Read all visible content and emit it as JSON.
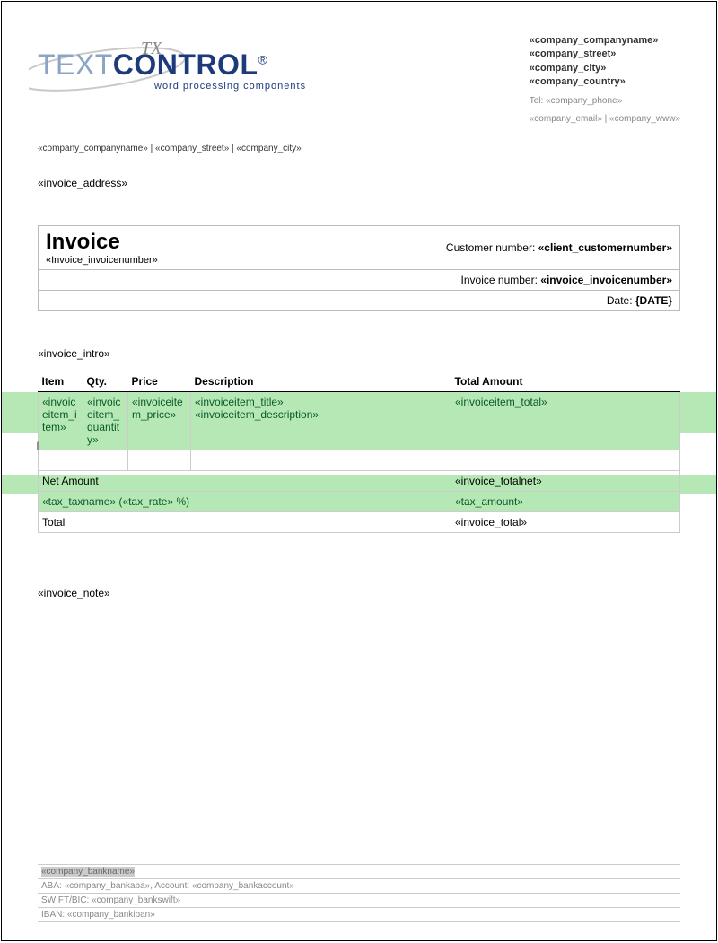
{
  "logo": {
    "text_light": "TEXT",
    "text_bold": "CONTROL",
    "reg": "®",
    "sub": "word processing components",
    "tx": "TX"
  },
  "company_block": {
    "l1": "«company_companyname»",
    "l2": "«company_street»",
    "l3": "«company_city»",
    "l4": "«company_country»",
    "tel_label": "Tel: ",
    "tel": "«company_phone»",
    "contact": "«company_email» | «company_www»"
  },
  "small_line": "«company_companyname» | «company_street» | «company_city»",
  "invoice_address": "«invoice_address»",
  "inv": {
    "title": "Invoice",
    "num_under": "«Invoice_invoicenumber»",
    "cust_label": "Customer number: ",
    "cust_val": "«client_customernumber»",
    "invnum_label": "Invoice number: ",
    "invnum_val": "«invoice_invoicenumber»",
    "date_label": "Date: ",
    "date_val": "{DATE}"
  },
  "intro": "«invoice_intro»",
  "cols": {
    "item": "Item",
    "qty": "Qty.",
    "price": "Price",
    "desc": "Description",
    "total": "Total Amount"
  },
  "row": {
    "item": "«invoiceitem_item»",
    "qty": "«invoiceitem_quantity»",
    "price": "«invoiceitem_price»",
    "title": "«invoiceitem_title»",
    "desc": "«invoiceitem_description»",
    "total": "«invoiceitem_total»"
  },
  "totals": {
    "net_label": "Net Amount",
    "net_val": "«invoice_totalnet»",
    "tax_name": "«tax_taxname»",
    "tax_rate": "«tax_rate»",
    "tax_pct": " %",
    "tax_val": "«tax_amount»",
    "total_label": "Total",
    "total_val": "«invoice_total»"
  },
  "note": "«invoice_note»",
  "footer": {
    "bankname": "«company_bankname»",
    "aba_label": "ABA: ",
    "aba": "«company_bankaba»",
    "acct_label": ", Account: ",
    "acct": "«company_bankaccount»",
    "swift_label": "SWIFT/BIC: ",
    "swift": "«company_bankswift»",
    "iban_label": "IBAN: ",
    "iban": "«company_bankiban»"
  }
}
